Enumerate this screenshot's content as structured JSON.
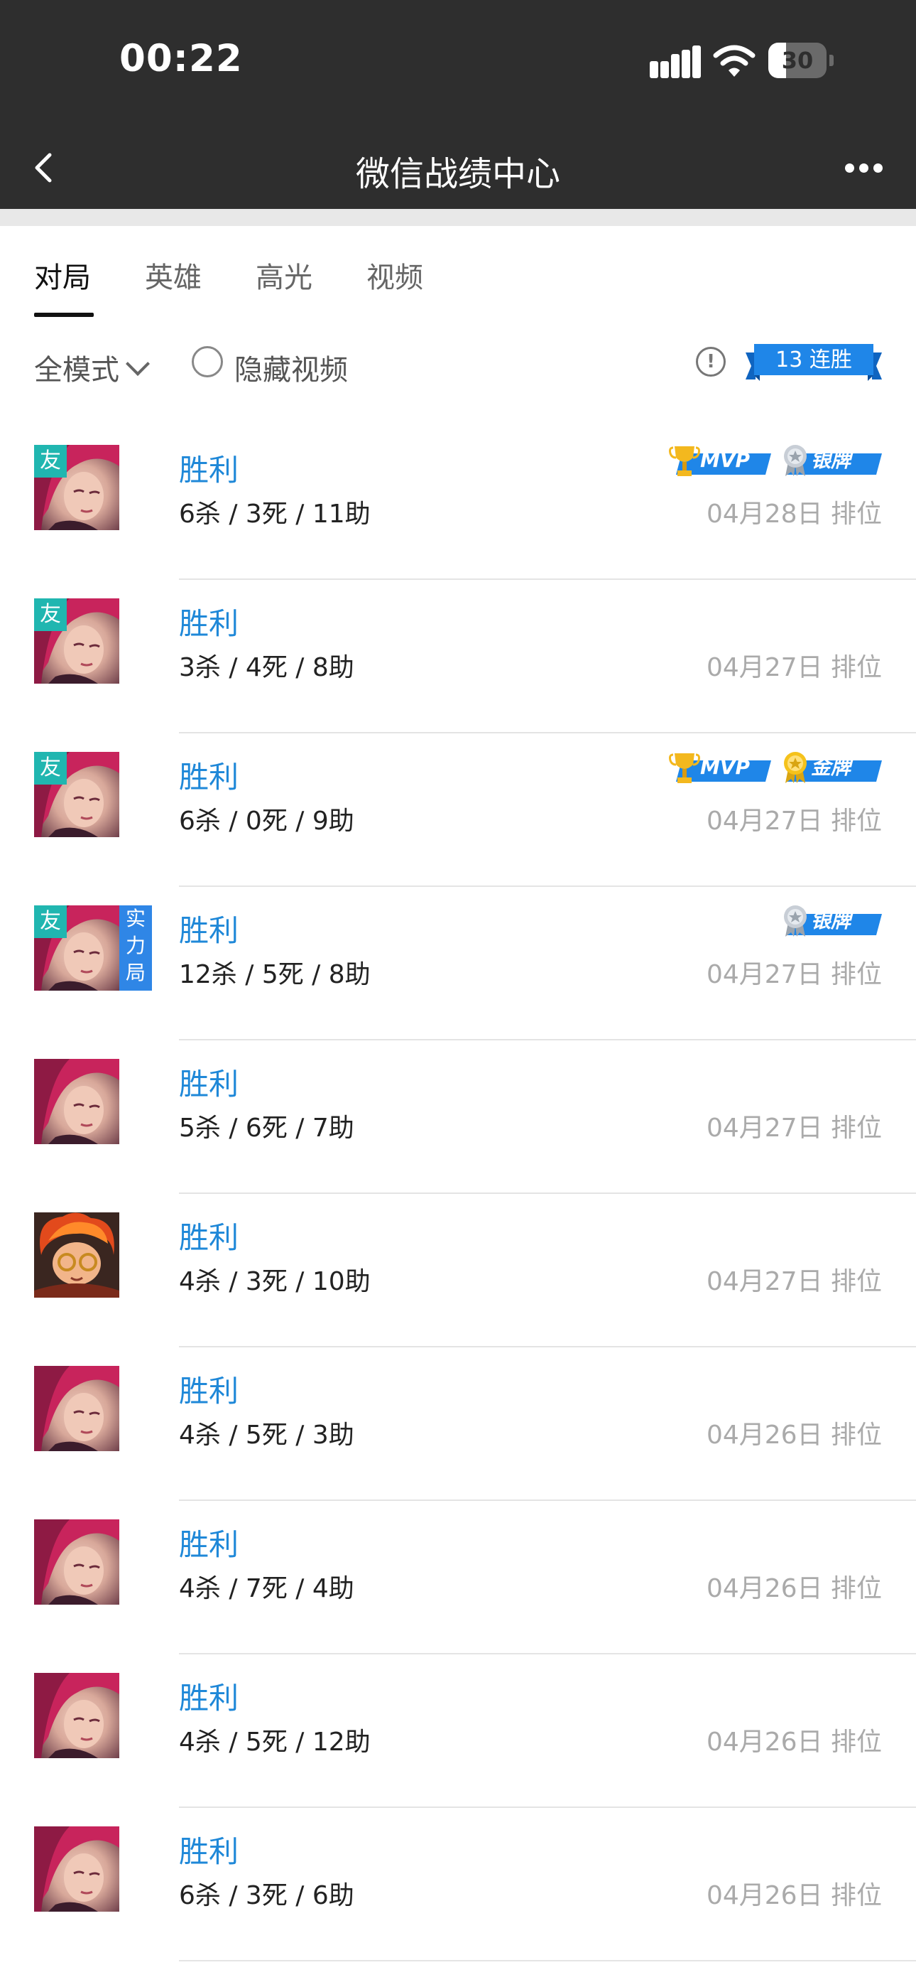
{
  "status_bar": {
    "time": "00:22",
    "battery": "30",
    "battery_level": 0.3
  },
  "nav": {
    "title": "微信战绩中心"
  },
  "tabs": [
    {
      "label": "对局",
      "active": true
    },
    {
      "label": "英雄",
      "active": false
    },
    {
      "label": "高光",
      "active": false
    },
    {
      "label": "视频",
      "active": false
    }
  ],
  "filter": {
    "mode_label": "全模式",
    "hide_video_label": "隐藏视频",
    "info_glyph": "!",
    "streak_label": "13 连胜"
  },
  "colors": {
    "accent": "#1f88d8",
    "friend_tag": "#20b6b0",
    "power_tag": "#2f86e6",
    "badge_blue": "#1f86e8"
  },
  "matches": [
    {
      "result": "胜利",
      "kda": "6杀 / 3死 / 11助",
      "meta": "04月28日  排位",
      "hero": "crimson-hair",
      "friend_tag": "友",
      "power_tag": "",
      "badges": [
        {
          "type": "mvp",
          "label": "MVP"
        },
        {
          "type": "silver",
          "label": "银牌"
        }
      ]
    },
    {
      "result": "胜利",
      "kda": "3杀 / 4死 / 8助",
      "meta": "04月27日  排位",
      "hero": "crimson-hair",
      "friend_tag": "友",
      "power_tag": "",
      "badges": []
    },
    {
      "result": "胜利",
      "kda": "6杀 / 0死 / 9助",
      "meta": "04月27日  排位",
      "hero": "crimson-hair",
      "friend_tag": "友",
      "power_tag": "",
      "badges": [
        {
          "type": "mvp",
          "label": "MVP"
        },
        {
          "type": "gold",
          "label": "金牌"
        }
      ]
    },
    {
      "result": "胜利",
      "kda": "12杀 / 5死 / 8助",
      "meta": "04月27日  排位",
      "hero": "crimson-hair",
      "friend_tag": "友",
      "power_tag": "实力局",
      "badges": [
        {
          "type": "silver",
          "label": "银牌"
        }
      ]
    },
    {
      "result": "胜利",
      "kda": "5杀 / 6死 / 7助",
      "meta": "04月27日  排位",
      "hero": "crimson-hair",
      "friend_tag": "",
      "power_tag": "",
      "badges": []
    },
    {
      "result": "胜利",
      "kda": "4杀 / 3死 / 10助",
      "meta": "04月27日  排位",
      "hero": "fire-hair",
      "friend_tag": "",
      "power_tag": "",
      "badges": []
    },
    {
      "result": "胜利",
      "kda": "4杀 / 5死 / 3助",
      "meta": "04月26日  排位",
      "hero": "crimson-hair",
      "friend_tag": "",
      "power_tag": "",
      "badges": []
    },
    {
      "result": "胜利",
      "kda": "4杀 / 7死 / 4助",
      "meta": "04月26日  排位",
      "hero": "crimson-hair",
      "friend_tag": "",
      "power_tag": "",
      "badges": []
    },
    {
      "result": "胜利",
      "kda": "4杀 / 5死 / 12助",
      "meta": "04月26日  排位",
      "hero": "crimson-hair",
      "friend_tag": "",
      "power_tag": "",
      "badges": []
    },
    {
      "result": "胜利",
      "kda": "6杀 / 3死 / 6助",
      "meta": "04月26日  排位",
      "hero": "crimson-hair",
      "friend_tag": "",
      "power_tag": "",
      "badges": []
    }
  ]
}
